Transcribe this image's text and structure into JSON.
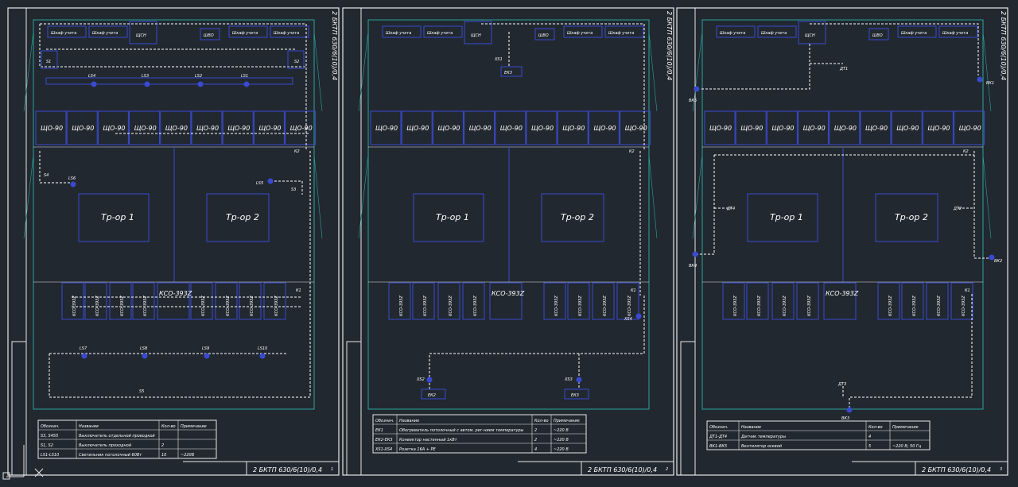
{
  "drawing_code": "2 БКТП 630/6(10)/0,4",
  "sheet_numbers": [
    "1",
    "2",
    "3"
  ],
  "colors": {
    "background": "#212830",
    "frame": "#e8e8e8",
    "equipment": "#3a4ad0",
    "route": "#ffffff",
    "accent": "#2aa39a"
  },
  "labels": {
    "shcho": "ЩО-90",
    "kso": "КСО-393Z",
    "kso_main": "КСО-393Z",
    "tr1": "Тр-ор 1",
    "tr2": "Тр-ор 2",
    "cabinet": "Шкаф учета",
    "shsn": "ЩСН",
    "shvo": "ШВО",
    "k1": "К1",
    "k2": "К2"
  },
  "sheets": [
    {
      "id": "sheet-1",
      "tags": {
        "ls": [
          "LS4",
          "LS3",
          "LS2",
          "LS1"
        ],
        "ls_bottom": [
          "LS7",
          "LS8",
          "LS9",
          "LS10"
        ],
        "s_left": "S1",
        "s_right": "S2",
        "s_bottom": "S5",
        "s4": "S4",
        "ls6": "LS6",
        "ls5": "LS5",
        "s3": "S3"
      },
      "table": {
        "headers": [
          "Обознач.",
          "Название",
          "Кол-во",
          "Примечание"
        ],
        "rows": [
          [
            "S3, S4S5",
            "Выключатель отдельной проводкой",
            "",
            ""
          ],
          [
            "S1, S2",
            "Выключатель проходной",
            "2",
            ""
          ],
          [
            "LS1-LS10",
            "Светильник потолочный 60Вт",
            "10",
            "~220В"
          ]
        ]
      }
    },
    {
      "id": "sheet-2",
      "tags": {
        "xs1": "XS1",
        "ek3_top": "ЕК3",
        "xs2": "XS2",
        "xs3": "XS3",
        "xs4": "XS4",
        "ek2": "ЕК2",
        "ek3": "ЕК3"
      },
      "table": {
        "headers": [
          "Обознач.",
          "Название",
          "Кол-во",
          "Примечание"
        ],
        "rows": [
          [
            "ЕК1",
            "Обогреватель потолочный с автом. рег-нием температуры",
            "2",
            "~220 В"
          ],
          [
            "ЕК2-ЕК3",
            "Конвектор настенный 1кВт",
            "2",
            "~220 В"
          ],
          [
            "XS1-XS4",
            "Розетка 16А + РЕ",
            "4",
            "~220 В"
          ]
        ]
      }
    },
    {
      "id": "sheet-3",
      "tags": {
        "dt1": "ДТ1",
        "dt2": "ДТ2",
        "dt3": "ДТ3",
        "dt4": "ДТ4",
        "vk1": "ВК1",
        "vk2": "ВК2",
        "vk3": "ВК3",
        "vk4": "ВК4",
        "vk5": "ВК5"
      },
      "table": {
        "headers": [
          "Обознач.",
          "Название",
          "Кол-во",
          "Примечание"
        ],
        "rows": [
          [
            "ДТ1-ДТ4",
            "Датчик температуры",
            "4",
            ""
          ],
          [
            "ВК1-ВК5",
            "Вентилятор осевой",
            "5",
            "~220 В; 50 Гц"
          ]
        ]
      }
    }
  ]
}
